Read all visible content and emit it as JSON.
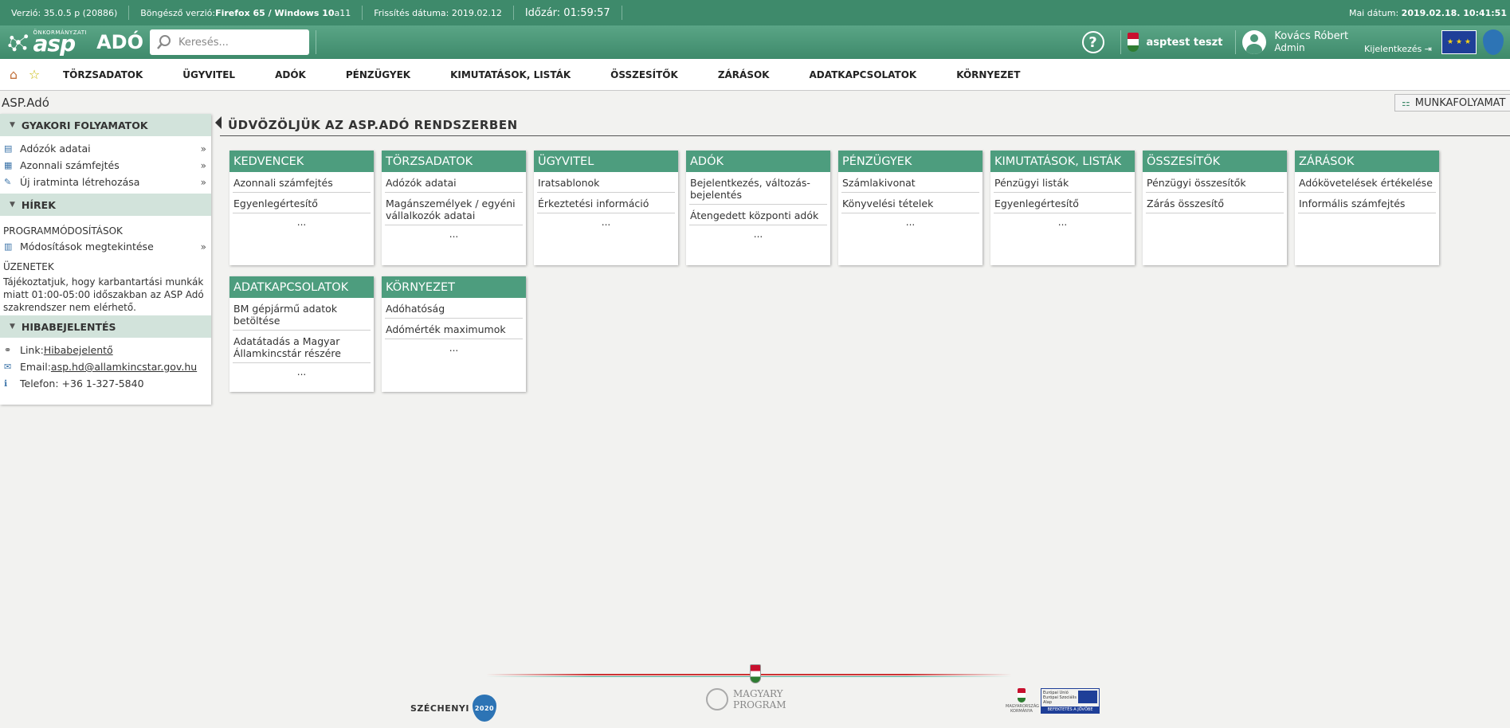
{
  "statusbar": {
    "version": "Verzió: 35.0.5 p (20886)",
    "browser_label": "Böngésző verzió: ",
    "browser_value": "Firefox 65 / Windows 10",
    "browser_suffix": " a11",
    "refresh": "Frissítés dátuma: 2019.02.12",
    "timer": "Időzár: 01:59:57",
    "date_label": "Mai dátum: ",
    "date_value": "2019.02.18. 10:41:51"
  },
  "header": {
    "logo_small": "ÖNKORMÁNYZATI",
    "logo_asp": "asp",
    "logo_ado": "ADÓ",
    "search_placeholder": "Keresés...",
    "help": "?",
    "tenant": "asptest teszt",
    "user_name": "Kovács Róbert",
    "user_role": "Admin",
    "logout": "Kijelentkezés",
    "logout_icon": "⇥"
  },
  "menu": {
    "items": [
      "TÖRZSADATOK",
      "ÜGYVITEL",
      "ADÓK",
      "PÉNZÜGYEK",
      "KIMUTATÁSOK, LISTÁK",
      "ÖSSZESÍTŐK",
      "ZÁRÁSOK",
      "ADATKAPCSOLATOK",
      "KÖRNYEZET"
    ]
  },
  "app_title": "ASP.Adó",
  "sidebar": {
    "frequent": {
      "title": "GYAKORI FOLYAMATOK",
      "items": [
        "Adózók adatai",
        "Azonnali számfejtés",
        "Új iratminta létrehozása"
      ]
    },
    "news": {
      "title": "HÍREK",
      "program_title": "PROGRAMMÓDOSÍTÁSOK",
      "program_item": "Módosítások megtekintése",
      "messages_title": "ÜZENETEK",
      "message": "Tájékoztatjuk, hogy karbantartási munkák miatt 01:00-05:00 időszakban az ASP Adó szakrendszer nem elérhető."
    },
    "report": {
      "title": "HIBABEJELENTÉS",
      "link_label": "Link: ",
      "link_value": "Hibabejelentő",
      "email_label": "Email:",
      "email_value": "asp.hd@allamkincstar.gov.hu",
      "phone": "Telefon: +36 1-327-5840"
    }
  },
  "workflow_button": "MUNKAFOLYAMAT",
  "welcome": "ÜDVÖZÖLJÜK AZ ASP.ADÓ RENDSZERBEN",
  "tiles": [
    {
      "title": "KEDVENCEK",
      "items": [
        "Azonnali számfejtés",
        "Egyenlegértesítő"
      ],
      "more": "..."
    },
    {
      "title": "TÖRZSADATOK",
      "items": [
        "Adózók adatai",
        "Magánszemélyek / egyéni vállalkozók adatai"
      ],
      "more": "..."
    },
    {
      "title": "ÜGYVITEL",
      "items": [
        "Iratsablonok",
        "Érkeztetési információ"
      ],
      "more": "..."
    },
    {
      "title": "ADÓK",
      "items": [
        "Bejelentkezés, változás-bejelentés",
        "Átengedett központi adók"
      ],
      "more": "..."
    },
    {
      "title": "PÉNZÜGYEK",
      "items": [
        "Számlakivonat",
        "Könyvelési tételek"
      ],
      "more": "..."
    },
    {
      "title": "KIMUTATÁSOK, LISTÁK",
      "items": [
        "Pénzügyi listák",
        "Egyenlegértesítő"
      ],
      "more": "..."
    },
    {
      "title": "ÖSSZESÍTŐK",
      "items": [
        "Pénzügyi összesítők",
        "Zárás összesítő"
      ],
      "more": ""
    },
    {
      "title": "ZÁRÁSOK",
      "items": [
        "Adókövetelések értékelése",
        "Informális számfejtés"
      ],
      "more": ""
    },
    {
      "title": "ADATKAPCSOLATOK",
      "items": [
        "BM gépjármű adatok betöltése",
        "Adatátadás a Magyar Államkincstár részére"
      ],
      "more": "..."
    },
    {
      "title": "KÖRNYEZET",
      "items": [
        "Adóhatóság",
        "Adómérték maximumok"
      ],
      "more": "..."
    }
  ],
  "footer": {
    "szechenyi": "SZÉCHENYI",
    "szechenyi_year": "2020",
    "magyary_1": "MAGYARY",
    "magyary_2": "PROGRAM",
    "kormany": "MAGYARORSZÁG KORMÁNYA",
    "eu_text": "Európai Unió Európai Szociális Alap",
    "eu_bar": "BEFEKTETÉS A JÖVŐBE"
  },
  "colors": {
    "brand_green": "#3e8a6b",
    "tile_header": "#4d9d7e",
    "sidebar_head": "#d2e3db"
  },
  "icons": {
    "home": "⌂",
    "star": "☆",
    "search": "⚲",
    "expand": "▼",
    "arrow": "»",
    "info": "ℹ"
  }
}
